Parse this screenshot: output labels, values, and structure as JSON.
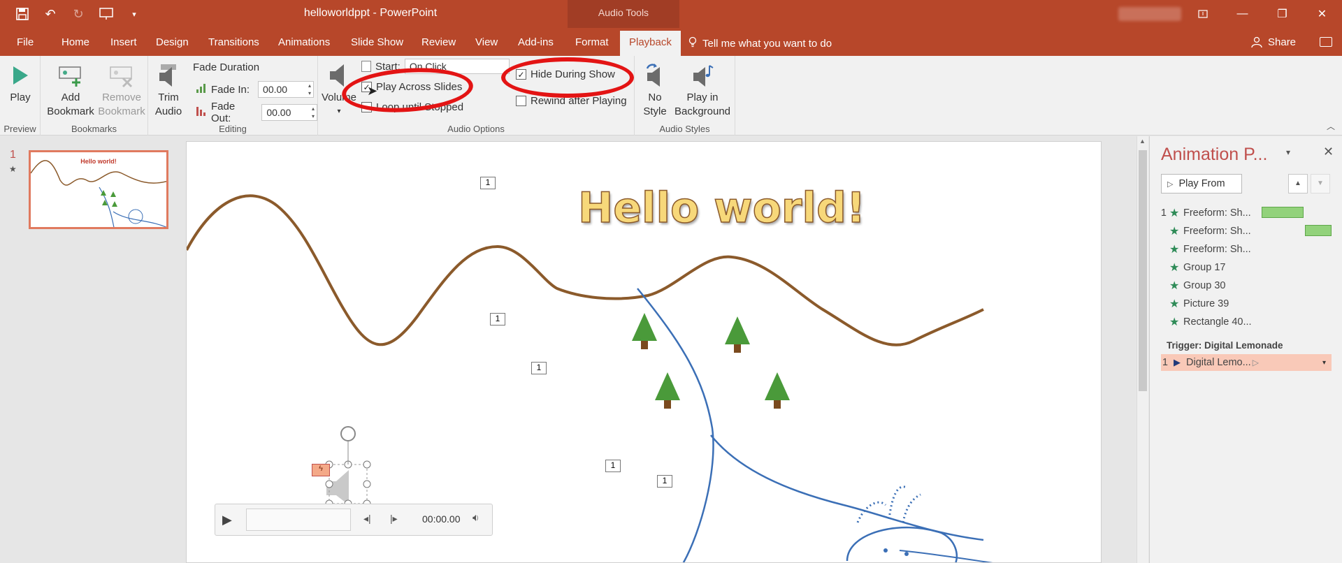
{
  "window": {
    "title": "helloworldppt  -  PowerPoint",
    "context_title": "Audio Tools"
  },
  "tabs": [
    "File",
    "Home",
    "Insert",
    "Design",
    "Transitions",
    "Animations",
    "Slide Show",
    "Review",
    "View",
    "Add-ins",
    "Format",
    "Playback"
  ],
  "tell_me": "Tell me what you want to do",
  "share": "Share",
  "ribbon": {
    "play": "Play",
    "preview_label": "Preview",
    "add_bookmark": [
      "Add",
      "Bookmark"
    ],
    "remove_bookmark": [
      "Remove",
      "Bookmark"
    ],
    "bookmarks_label": "Bookmarks",
    "trim_audio": [
      "Trim",
      "Audio"
    ],
    "fade_duration": "Fade Duration",
    "fade_in": "Fade In:",
    "fade_in_value": "00.00",
    "fade_out": "Fade Out:",
    "fade_out_value": "00.00",
    "editing_label": "Editing",
    "volume": "Volume",
    "start_label": "Start:",
    "start_value": "On Click",
    "play_across_slides": "Play Across Slides",
    "loop_until_stopped": "Loop until Stopped",
    "hide_during_show": "Hide During Show",
    "rewind_after_playing": "Rewind after Playing",
    "audio_options_label": "Audio Options",
    "no_style": [
      "No",
      "Style"
    ],
    "play_in_background": [
      "Play in",
      "Background"
    ],
    "audio_styles_label": "Audio Styles",
    "checked": {
      "play_across_slides": true,
      "loop_until_stopped": false,
      "hide_during_show": true,
      "rewind_after_playing": false
    }
  },
  "thumbnails": [
    {
      "number": "1",
      "title": "Hello world!"
    }
  ],
  "slide": {
    "title": "Hello world!",
    "anim_tags": [
      "1",
      "1",
      "1",
      "1",
      "1"
    ],
    "media": {
      "time": "00:00.00"
    }
  },
  "animation_pane": {
    "title": "Animation P...",
    "play_from": "Play From",
    "items": [
      {
        "num": "1",
        "label": "Freeform: Sh...",
        "bar": true
      },
      {
        "num": "",
        "label": "Freeform: Sh...",
        "bar": true
      },
      {
        "num": "",
        "label": "Freeform: Sh...",
        "bar": false
      },
      {
        "num": "",
        "label": "Group 17",
        "bar": false
      },
      {
        "num": "",
        "label": "Group 30",
        "bar": false
      },
      {
        "num": "",
        "label": "Picture 39",
        "bar": false
      },
      {
        "num": "",
        "label": "Rectangle 40...",
        "bar": false
      }
    ],
    "trigger": "Trigger: Digital Lemonade",
    "trigger_item": {
      "num": "1",
      "label": "Digital Lemo..."
    }
  },
  "colors": {
    "accent": "#b7472a",
    "highlight": "#e31414",
    "anim_star": "#2e8b57",
    "trigger_row": "#f9c9b8"
  }
}
